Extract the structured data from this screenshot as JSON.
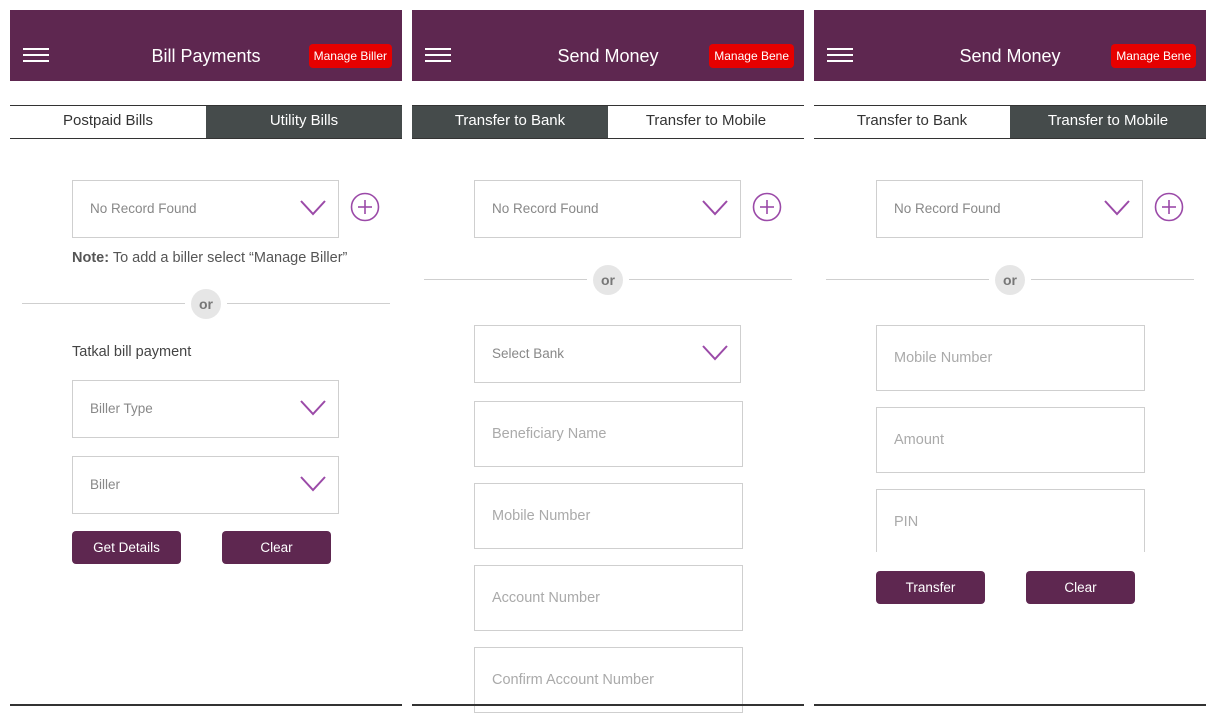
{
  "colors": {
    "header_bg": "#5e2750",
    "manage_bg": "#e60000",
    "tab_active_bg": "#454b4b",
    "button_bg": "#5e2750",
    "accent": "#9b4aa8"
  },
  "icons": {
    "menu": "hamburger-icon",
    "dropdown": "chevron-down-icon",
    "add": "plus-circle-icon"
  },
  "panel1": {
    "title": "Bill Payments",
    "manage_label": "Manage Biller",
    "tabs": [
      "Postpaid Bills",
      "Utility Bills"
    ],
    "record_dropdown": "No Record Found",
    "note_bold": "Note:",
    "note_text": " To add a biller select “Manage Biller”",
    "or_label": "or",
    "tatkal_label": "Tatkal bill payment",
    "biller_type": "Biller Type",
    "biller": "Biller",
    "get_details_label": "Get Details",
    "clear_label": "Clear"
  },
  "panel2": {
    "title": "Send Money",
    "manage_label": "Manage Bene",
    "tabs": [
      "Transfer to Bank",
      "Transfer to Mobile"
    ],
    "record_dropdown": "No Record Found",
    "or_label": "or",
    "select_bank": "Select Bank",
    "fields": [
      "Beneficiary Name",
      "Mobile Number",
      "Account Number",
      "Confirm Account Number"
    ]
  },
  "panel3": {
    "title": "Send Money",
    "manage_label": "Manage Bene",
    "tabs": [
      "Transfer to Bank",
      "Transfer to Mobile"
    ],
    "record_dropdown": "No Record Found",
    "or_label": "or",
    "fields": [
      "Mobile Number",
      "Amount",
      "PIN"
    ],
    "transfer_label": "Transfer",
    "clear_label": "Clear"
  }
}
